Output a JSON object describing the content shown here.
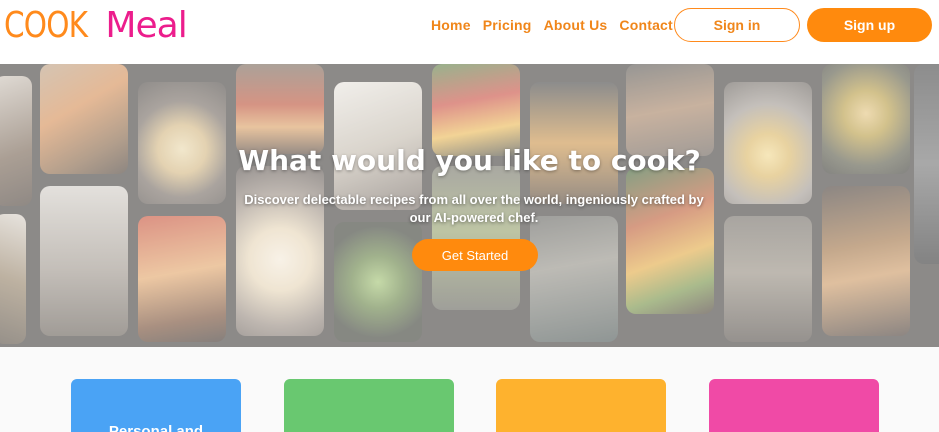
{
  "brand": {
    "part1": "COOK",
    "part2": "Meal"
  },
  "nav": {
    "links": [
      "Home",
      "Pricing",
      "About Us",
      "Contact"
    ],
    "signin_label": "Sign in",
    "signup_label": "Sign up"
  },
  "hero": {
    "title": "What would you like to cook?",
    "subtitle": "Discover delectable recipes from all over the world, ingeniously crafted by our AI-powered chef.",
    "cta_label": "Get Started"
  },
  "cards": [
    {
      "title": "Personal and",
      "color": "#4aa3f5"
    },
    {
      "title": "",
      "color": "#69c870"
    },
    {
      "title": "",
      "color": "#feb22e"
    },
    {
      "title": "",
      "color": "#f04aa6"
    }
  ],
  "colors": {
    "accent_orange": "#ff8a0d",
    "brand_pink": "#ec1d8c"
  }
}
